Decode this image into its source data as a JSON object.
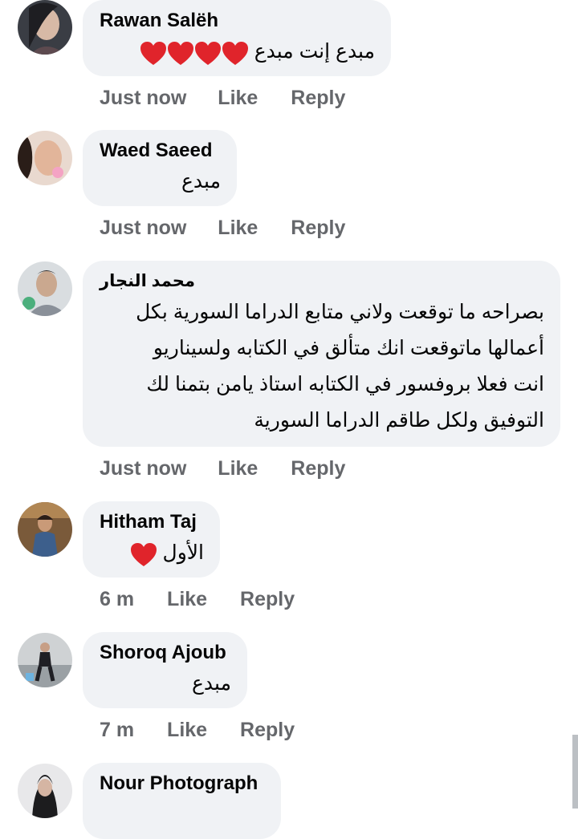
{
  "comments": [
    {
      "author": "Rawan Salëh",
      "text": "مبدع إنت مبدع",
      "heart_count": 4,
      "time": "Just now",
      "like_label": "Like",
      "reply_label": "Reply"
    },
    {
      "author": "Waed Saeed",
      "text": "مبدع",
      "time": "Just now",
      "like_label": "Like",
      "reply_label": "Reply"
    },
    {
      "author": "محمد النجار",
      "text_lines": [
        "بصراحه ما توقعت ولاني متابع الدراما السورية بكل",
        "أعمالها ماتوقعت انك متألق في الكتابه ولسيناريو",
        "انت فعلا بروفسور في الكتابه استاذ يامن بتمنا لك",
        "التوفيق ولكل طاقم الدراما السورية"
      ],
      "time": "Just now",
      "like_label": "Like",
      "reply_label": "Reply"
    },
    {
      "author": "Hitham Taj",
      "text": "الأول",
      "heart_count": 1,
      "time": "6 m",
      "like_label": "Like",
      "reply_label": "Reply"
    },
    {
      "author": "Shoroq Ajoub",
      "text": "مبدع",
      "time": "7 m",
      "like_label": "Like",
      "reply_label": "Reply"
    },
    {
      "author": "Nour Photograph"
    }
  ],
  "colors": {
    "bubble": "#f0f2f5",
    "meta_text": "#65676b",
    "heart": "#e0242b"
  }
}
